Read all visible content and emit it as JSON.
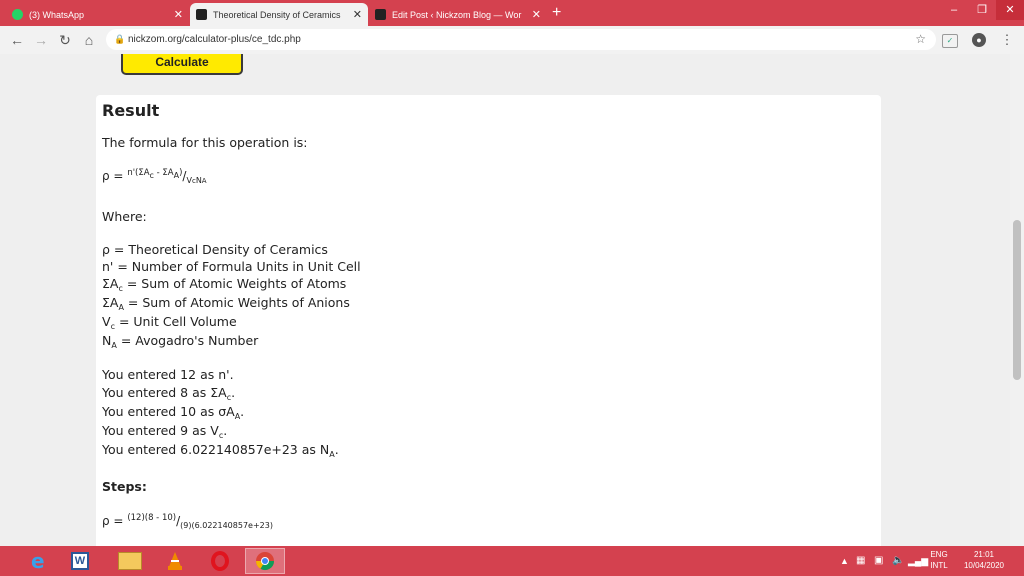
{
  "browser": {
    "tabs": [
      {
        "title": "(3) WhatsApp",
        "state": "inactive",
        "fav_color": "#25d366"
      },
      {
        "title": "Theoretical Density of Ceramics",
        "state": "active",
        "fav_color": "#222222"
      },
      {
        "title": "Edit Post ‹ Nickzom Blog — Wor",
        "state": "inactive",
        "fav_color": "#222222"
      }
    ],
    "url": "nickzom.org/calculator-plus/ce_tdc.php",
    "accent_color": "#d4414f"
  },
  "page": {
    "calculate_label": "Calculate",
    "result": {
      "heading": "Result",
      "formula_intro": "The formula for this operation is:",
      "where_label": "Where:",
      "defs": [
        "ρ = Theoretical Density of Ceramics",
        "n' = Number of Formula Units in Unit Cell",
        "= Sum of Atomic Weights of Atoms",
        "= Sum of Atomic Weights of Anions",
        "= Unit Cell Volume",
        "= Avogadro's Number"
      ],
      "entries": {
        "n": "You entered 12 as n'.",
        "ac_prefix": "You entered 8 as ΣA",
        "aa_prefix": "You entered 10 as σA",
        "vc_prefix": "You entered 9 as V",
        "na_prefix": "You entered 6.022140857e+23 as N"
      },
      "steps_label": "Steps:",
      "steps_numerator": "(12)(8 - 10)",
      "steps_denominator": "(9)(6.022140857e+23)"
    }
  },
  "taskbar": {
    "lang": "ENG",
    "layout": "INTL",
    "time": "21:01",
    "date": "10/04/2020"
  }
}
